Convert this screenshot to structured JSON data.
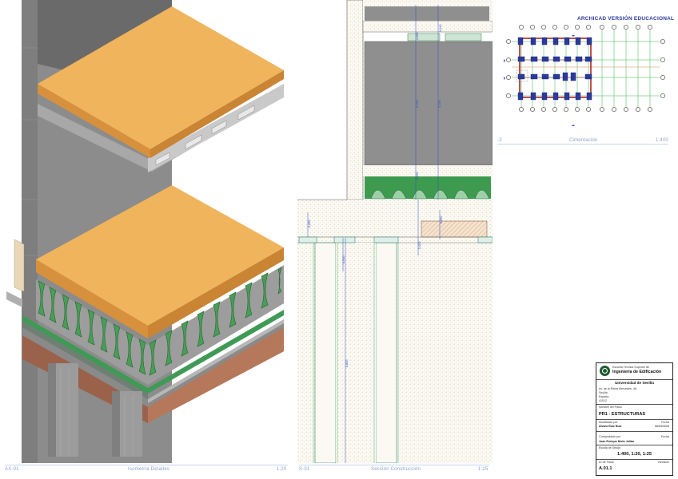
{
  "header": {
    "title": "ARCHICAD VERSIÓN EDUCACIONAL"
  },
  "panels": {
    "isometric": {
      "code": "AX-01",
      "name": "Isometría Detalles",
      "scale": "1:20"
    },
    "section": {
      "code": "S-01",
      "name": "Sección Construcción",
      "scale": "1:25"
    },
    "foundation": {
      "code": "-3",
      "name": "Cimentación",
      "scale": "1:400"
    }
  },
  "section_dims": {
    "d1": "2,050",
    "d2": "0,040",
    "d3": "3,750",
    "d4": "3,750",
    "d5": "0,400",
    "d6": "0,400",
    "d7": "0,050",
    "d8": "0,050",
    "d9": "5,800",
    "d10": "0,050"
  },
  "titleblock": {
    "school_line1": "Escuela Técnica Superior de",
    "school_line2": "Ingeniería de Edificación",
    "university": "Universidad de Sevilla",
    "address1": "Av. de la Reina Mercedes, 4A",
    "address2": "Sevilla",
    "address3": "España",
    "address4": "41012",
    "plan_name_label": "Nombre del Plano",
    "plan_name": "PR1 - ESTRUCTURAS",
    "modified_label": "Modificado por",
    "modified_by": "Álvaro Ruiz Ruiz",
    "date_label": "Fecha",
    "date": "06/03/2025",
    "checked_label": "Comprobado por",
    "checked_by": "Juan Enrique Nieto Julián",
    "date_label2": "Fecha",
    "scale_label": "Escala de Dibujo",
    "scale": "1:400, 1:20, 1:25",
    "plan_id_label": "ID de Plano",
    "revision_label": "Revisión",
    "plan_id": "A.01.1"
  },
  "colors": {
    "slab_top": "#f0b45c",
    "slab_side": "#d7913d",
    "concrete": "#9a9a9a",
    "rebar_green": "#2f8a3a",
    "foundation_brown": "#b5785a",
    "caption_blue": "#8aa0c8",
    "grid_green": "#39b54a",
    "beam_red": "#b02424",
    "pile_blue": "#2b3a9c"
  }
}
